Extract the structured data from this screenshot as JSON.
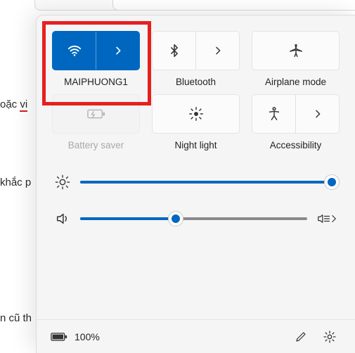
{
  "bg": {
    "line1a": "oặc ",
    "line1b": "vi",
    "line2": "khắc p",
    "line3": "n cũ th"
  },
  "tiles": {
    "wifi": {
      "label": "MAIPHUONG1"
    },
    "bluetooth": {
      "label": "Bluetooth"
    },
    "airplane": {
      "label": "Airplane mode"
    },
    "battery": {
      "label": "Battery saver"
    },
    "nightlight": {
      "label": "Night light"
    },
    "access": {
      "label": "Accessibility"
    }
  },
  "sliders": {
    "brightness": {
      "value": 98
    },
    "volume": {
      "value": 42
    }
  },
  "footer": {
    "battery_pct": "100%"
  }
}
